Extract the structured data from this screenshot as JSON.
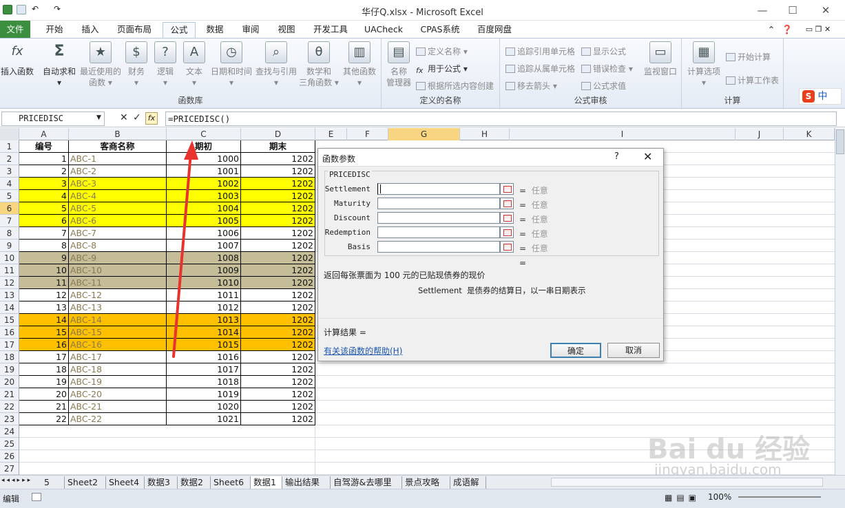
{
  "window": {
    "title": "华仔Q.xlsx - Microsoft Excel"
  },
  "tabs": [
    "文件",
    "开始",
    "插入",
    "页面布局",
    "公式",
    "数据",
    "审阅",
    "视图",
    "开发工具",
    "UACheck",
    "CPAS系统",
    "百度网盘"
  ],
  "ribbon": {
    "insert_fn": "插入函数",
    "autosum": "自动求和",
    "recent": [
      "最近使用的",
      "函数"
    ],
    "finance": "财务",
    "logic": "逻辑",
    "text": "文本",
    "datetime": "日期和时间",
    "lookup": "查找与引用",
    "math": [
      "数学和",
      "三角函数"
    ],
    "other": "其他函数",
    "group_fnlib": "函数库",
    "name_mgr": [
      "名称",
      "管理器"
    ],
    "define_name": "定义名称",
    "use_in_formula": "用于公式",
    "create_from_sel": "根据所选内容创建",
    "group_names": "定义的名称",
    "trace_prec": "追踪引用单元格",
    "trace_dep": "追踪从属单元格",
    "remove_arrows": "移去箭头",
    "show_formulas": "显示公式",
    "error_check": "错误检查",
    "eval_formula": "公式求值",
    "watch": "监视窗口",
    "group_audit": "公式审核",
    "calc_opts": "计算选项",
    "calc_now": "开始计算",
    "calc_sheet": "计算工作表",
    "group_calc": "计算",
    "ime": "中"
  },
  "formula_bar": {
    "name_box": "PRICEDISC",
    "fx": "fx",
    "formula": "=PRICEDISC()"
  },
  "columns": [
    "A",
    "B",
    "C",
    "D",
    "E",
    "F",
    "G",
    "H",
    "I",
    "J",
    "K"
  ],
  "rows": [
    "1",
    "2",
    "3",
    "4",
    "5",
    "6",
    "7",
    "8",
    "9",
    "10",
    "11",
    "12",
    "13",
    "14",
    "15",
    "16",
    "17",
    "18",
    "19",
    "20",
    "21",
    "22",
    "23",
    "24",
    "25",
    "26",
    "27"
  ],
  "headers": {
    "a": "编号",
    "b": "客商名称",
    "c": "期初",
    "d": "期末"
  },
  "data": [
    {
      "a": "1",
      "b": "ABC-1",
      "c": "1000",
      "d": "1202",
      "color": "#ffffff"
    },
    {
      "a": "2",
      "b": "ABC-2",
      "c": "1001",
      "d": "1202",
      "color": "#ffffff"
    },
    {
      "a": "3",
      "b": "ABC-3",
      "c": "1002",
      "d": "1202",
      "color": "#ffff00"
    },
    {
      "a": "4",
      "b": "ABC-4",
      "c": "1003",
      "d": "1202",
      "color": "#ffff00"
    },
    {
      "a": "5",
      "b": "ABC-5",
      "c": "1004",
      "d": "1202",
      "color": "#ffff00"
    },
    {
      "a": "6",
      "b": "ABC-6",
      "c": "1005",
      "d": "1202",
      "color": "#ffff00"
    },
    {
      "a": "7",
      "b": "ABC-7",
      "c": "1006",
      "d": "1202",
      "color": "#ffffff"
    },
    {
      "a": "8",
      "b": "ABC-8",
      "c": "1007",
      "d": "1202",
      "color": "#ffffff"
    },
    {
      "a": "9",
      "b": "ABC-9",
      "c": "1008",
      "d": "1202",
      "color": "#c4bd97"
    },
    {
      "a": "10",
      "b": "ABC-10",
      "c": "1009",
      "d": "1202",
      "color": "#c4bd97"
    },
    {
      "a": "11",
      "b": "ABC-11",
      "c": "1010",
      "d": "1202",
      "color": "#c4bd97"
    },
    {
      "a": "12",
      "b": "ABC-12",
      "c": "1011",
      "d": "1202",
      "color": "#ffffff"
    },
    {
      "a": "13",
      "b": "ABC-13",
      "c": "1012",
      "d": "1202",
      "color": "#ffffff"
    },
    {
      "a": "14",
      "b": "ABC-14",
      "c": "1013",
      "d": "1202",
      "color": "#ffc000"
    },
    {
      "a": "15",
      "b": "ABC-15",
      "c": "1014",
      "d": "1202",
      "color": "#ffc000"
    },
    {
      "a": "16",
      "b": "ABC-16",
      "c": "1015",
      "d": "1202",
      "color": "#ffc000"
    },
    {
      "a": "17",
      "b": "ABC-17",
      "c": "1016",
      "d": "1202",
      "color": "#ffffff"
    },
    {
      "a": "18",
      "b": "ABC-18",
      "c": "1017",
      "d": "1202",
      "color": "#ffffff"
    },
    {
      "a": "19",
      "b": "ABC-19",
      "c": "1018",
      "d": "1202",
      "color": "#ffffff"
    },
    {
      "a": "20",
      "b": "ABC-20",
      "c": "1019",
      "d": "1202",
      "color": "#ffffff"
    },
    {
      "a": "21",
      "b": "ABC-21",
      "c": "1020",
      "d": "1202",
      "color": "#ffffff"
    },
    {
      "a": "22",
      "b": "ABC-22",
      "c": "1021",
      "d": "1202",
      "color": "#ffffff"
    }
  ],
  "dialog": {
    "title": "函数参数",
    "help_q": "?",
    "close": "✕",
    "fn_name": "PRICEDISC",
    "params": [
      "Settlement",
      "Maturity",
      "Discount",
      "Redemption",
      "Basis"
    ],
    "eq": "=",
    "any": "任意",
    "description": "返回每张票面为 100 元的已贴现债券的现价",
    "param_desc": "Settlement  是债券的结算日，以一串日期表示",
    "result_label": "计算结果 =",
    "help_link": "有关该函数的帮助(H)",
    "ok": "确定",
    "cancel": "取消"
  },
  "sheets": [
    "5",
    "Sheet2",
    "Sheet4",
    "数据3",
    "数据2",
    "Sheet6",
    "数据1",
    "输出结果",
    "自驾游&去哪里",
    "景点攻略",
    "成语解"
  ],
  "active_sheet": "数据1",
  "status": {
    "mode": "编辑",
    "zoom": "100%"
  },
  "watermark": {
    "brand": "Bai du 经验",
    "url": "jingyan.baidu.com"
  }
}
